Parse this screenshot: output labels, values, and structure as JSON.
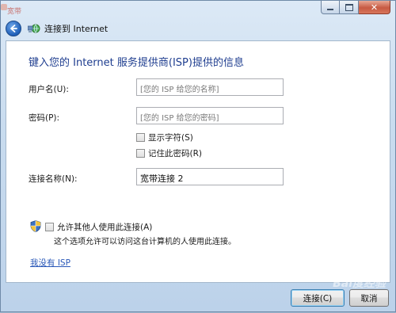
{
  "window": {
    "ghost_title": "宽带",
    "controls": {
      "minimize": "minimize-icon",
      "maximize": "maximize-icon",
      "close": "close-icon"
    }
  },
  "nav": {
    "title": "连接到 Internet"
  },
  "form": {
    "heading": "键入您的 Internet 服务提供商(ISP)提供的信息",
    "username_label": "用户名(U):",
    "username_placeholder": "[您的 ISP 给您的名称]",
    "password_label": "密码(P):",
    "password_placeholder": "[您的 ISP 给您的密码]",
    "show_chars_label": "显示字符(S)",
    "remember_password_label": "记住此密码(R)",
    "connection_name_label": "连接名称(N):",
    "connection_name_value": "宽带连接 2",
    "allow_others_label": "允许其他人使用此连接(A)",
    "allow_others_desc": "这个选项允许可以访问这台计算机的人使用此连接。",
    "no_isp_link": "我没有 ISP"
  },
  "buttons": {
    "connect": "连接(C)",
    "cancel": "取消"
  },
  "watermark": "Bai度经验",
  "colors": {
    "heading": "#1e3d8f",
    "link": "#2a58b8",
    "close_button": "#c75a43"
  }
}
